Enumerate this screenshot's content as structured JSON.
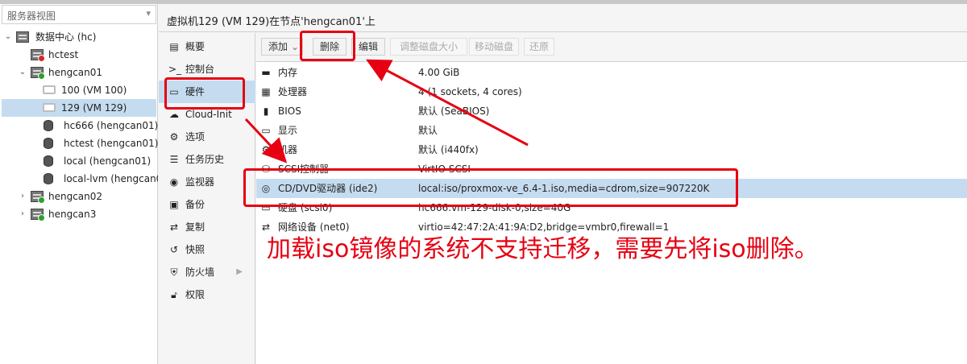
{
  "left_panel": {
    "view_select": "服务器视图",
    "tree": [
      {
        "label": "数据中心 (hc)",
        "type": "datacenter",
        "expanded": true
      },
      {
        "label": "hctest",
        "type": "node",
        "status": "error"
      },
      {
        "label": "hengcan01",
        "type": "node",
        "status": "ok",
        "expanded": true
      },
      {
        "label": "100 (VM 100)",
        "type": "vm"
      },
      {
        "label": "129 (VM 129)",
        "type": "vm",
        "selected": true
      },
      {
        "label": "hc666 (hengcan01)",
        "type": "storage"
      },
      {
        "label": "hctest (hengcan01)",
        "type": "storage"
      },
      {
        "label": "local (hengcan01)",
        "type": "storage"
      },
      {
        "label": "local-lvm (hengcan01)",
        "type": "storage"
      },
      {
        "label": "hengcan02",
        "type": "node",
        "status": "ok",
        "expanded": false
      },
      {
        "label": "hengcan3",
        "type": "node",
        "status": "ok",
        "expanded": false
      }
    ]
  },
  "header": {
    "title": "虚拟机129 (VM 129)在节点'hengcan01'上"
  },
  "menu": [
    {
      "label": "概要",
      "icon": "document-icon"
    },
    {
      "label": "控制台",
      "icon": "terminal-icon"
    },
    {
      "label": "硬件",
      "icon": "monitor-icon",
      "selected": true
    },
    {
      "label": "Cloud-Init",
      "icon": "cloud-icon"
    },
    {
      "label": "选项",
      "icon": "gear-icon"
    },
    {
      "label": "任务历史",
      "icon": "list-icon"
    },
    {
      "label": "监视器",
      "icon": "eye-icon"
    },
    {
      "label": "备份",
      "icon": "floppy-icon"
    },
    {
      "label": "复制",
      "icon": "retweet-icon"
    },
    {
      "label": "快照",
      "icon": "history-icon"
    },
    {
      "label": "防火墙",
      "icon": "shield-icon",
      "has_submenu": true
    },
    {
      "label": "权限",
      "icon": "unlock-icon"
    }
  ],
  "toolbar": {
    "add_label": "添加",
    "delete_label": "删除",
    "edit_label": "编辑",
    "resize_label": "调整磁盘大小",
    "move_label": "移动磁盘",
    "revert_label": "还原"
  },
  "hardware": [
    {
      "key": "内存",
      "value": "4.00 GiB",
      "icon": "memory-icon"
    },
    {
      "key": "处理器",
      "value": "4 (1 sockets, 4 cores)",
      "icon": "cpu-icon"
    },
    {
      "key": "BIOS",
      "value": "默认 (SeaBIOS)",
      "icon": "microchip-icon"
    },
    {
      "key": "显示",
      "value": "默认",
      "icon": "desktop-icon"
    },
    {
      "key": "机器",
      "value": "默认 (i440fx)",
      "icon": "cogs-icon"
    },
    {
      "key": "SCSI控制器",
      "value": "VirtIO SCSI",
      "icon": "database-icon"
    },
    {
      "key": "CD/DVD驱动器 (ide2)",
      "value": "local:iso/proxmox-ve_6.4-1.iso,media=cdrom,size=907220K",
      "icon": "cdrom-icon",
      "selected": true
    },
    {
      "key": "硬盘 (scsi0)",
      "value": "hc666:vm-129-disk-0,size=40G",
      "icon": "hdd-icon"
    },
    {
      "key": "网络设备 (net0)",
      "value": "virtio=42:47:2A:41:9A:D2,bridge=vmbr0,firewall=1",
      "icon": "exchange-icon"
    }
  ],
  "annotation": {
    "text": "加载iso镜像的系统不支持迁移，需要先将iso删除。",
    "color": "#e60012"
  }
}
